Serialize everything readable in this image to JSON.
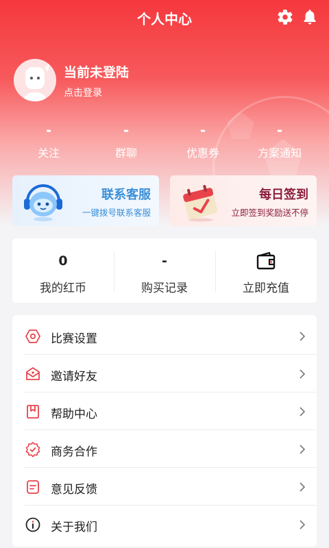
{
  "header": {
    "title": "个人中心",
    "settings_icon": "gear-icon",
    "notify_icon": "bell-icon"
  },
  "profile": {
    "name": "当前未登陆",
    "subtitle": "点击登录"
  },
  "stats": [
    {
      "value": "-",
      "label": "关注"
    },
    {
      "value": "-",
      "label": "群聊"
    },
    {
      "value": "-",
      "label": "优惠券"
    },
    {
      "value": "-",
      "label": "方案通知"
    }
  ],
  "cards": {
    "service": {
      "title": "联系客服",
      "subtitle": "一键拨号联系客服",
      "title_color": "#3b8fd8",
      "subtitle_color": "#3b8fd8"
    },
    "checkin": {
      "title": "每日签到",
      "subtitle": "立即签到奖励送不停",
      "title_color": "#8a1c3a",
      "subtitle_color": "#8a1c3a"
    }
  },
  "panel": [
    {
      "value": "0",
      "label": "我的红币"
    },
    {
      "value": "-",
      "label": "购买记录"
    },
    {
      "icon": "wallet-icon",
      "label": "立即充值"
    }
  ],
  "menu": [
    {
      "label": "比赛设置",
      "icon": "hexagon-icon"
    },
    {
      "label": "邀请好友",
      "icon": "envelope-heart-icon"
    },
    {
      "label": "帮助中心",
      "icon": "bookmark-icon"
    },
    {
      "label": "商务合作",
      "icon": "badge-check-icon"
    },
    {
      "label": "意见反馈",
      "icon": "feedback-icon"
    },
    {
      "label": "关于我们",
      "icon": "info-icon"
    }
  ],
  "colors": {
    "accent": "#f5383d",
    "icon_red": "#e8434b"
  }
}
